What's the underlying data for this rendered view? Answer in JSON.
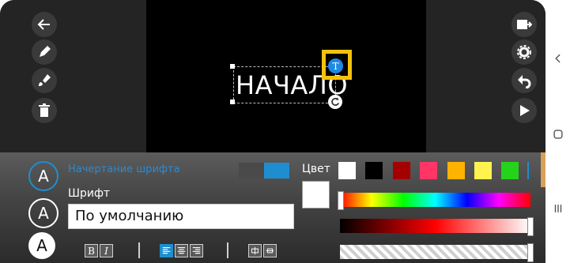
{
  "toolbar_left": [
    "back-icon",
    "pencil-icon",
    "brush-icon",
    "trash-icon"
  ],
  "toolbar_right": [
    "export-video-icon",
    "gear-icon",
    "undo-icon",
    "play-icon"
  ],
  "canvas": {
    "text": "НАЧАЛО",
    "text_badge": "T"
  },
  "panel": {
    "section_title": "Начертание шрифта",
    "font_label": "Шрифт",
    "font_value": "По умолчанию",
    "color_label": "Цвет",
    "format_buttons": [
      "B",
      "I"
    ],
    "align_buttons": [
      "align-left-icon",
      "align-center-icon",
      "align-right-icon"
    ],
    "extra_buttons": [
      "layout-icon-1",
      "layout-icon-2"
    ],
    "colors": [
      "#ffffff",
      "#000000",
      "#a50000",
      "#ff3566",
      "#ffb300",
      "#fff34f",
      "#26d31b"
    ],
    "selected_color": "#ffffff",
    "accent": "#1f8ed0"
  },
  "styles": [
    "A",
    "A",
    "A"
  ]
}
